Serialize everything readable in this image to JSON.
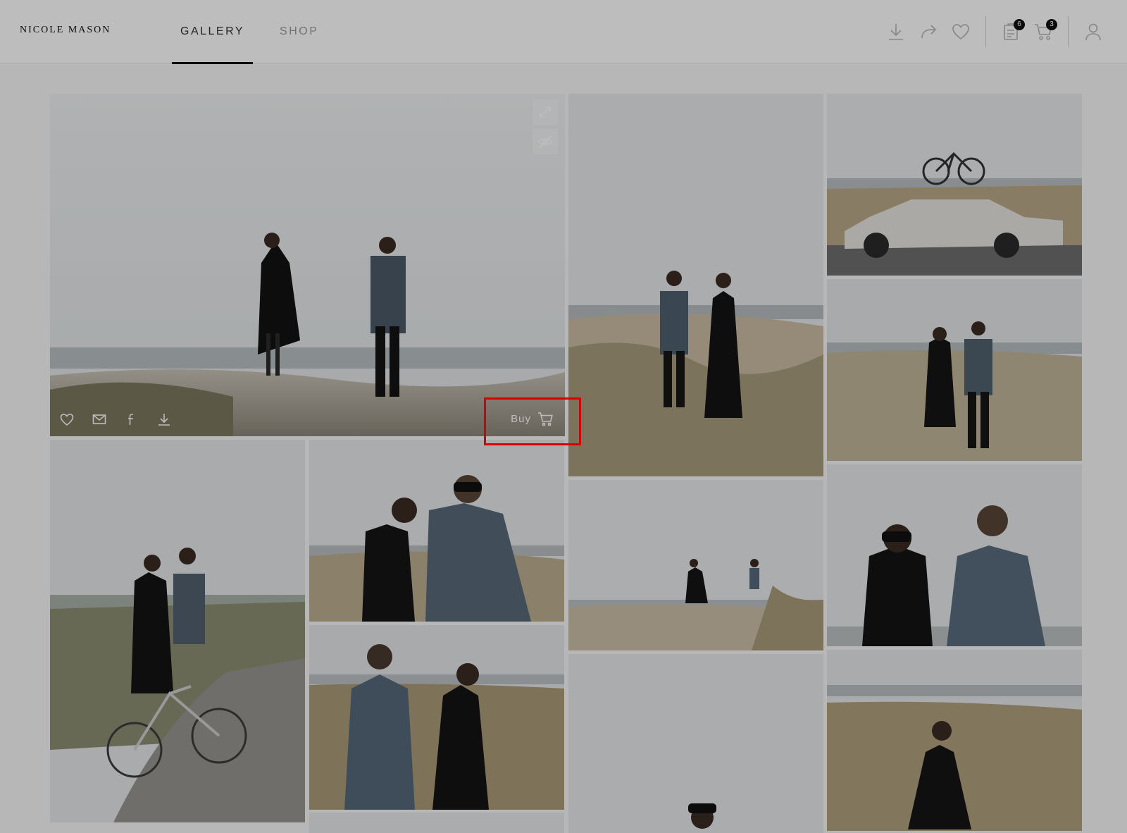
{
  "header": {
    "brand": "NICOLE MASON",
    "tabs": [
      {
        "label": "GALLERY",
        "active": true
      },
      {
        "label": "SHOP",
        "active": false
      }
    ],
    "icons": {
      "download": "download-icon",
      "share": "share-icon",
      "favorite": "heart-icon",
      "clipboard": "clipboard-icon",
      "cart": "cart-icon",
      "account": "user-icon"
    },
    "clipboard_count": "6",
    "cart_count": "3"
  },
  "featured_photo": {
    "buy_label": "Buy",
    "icons": [
      "heart-icon",
      "email-icon",
      "facebook-icon",
      "download-icon"
    ],
    "top_icons": [
      "expand-icon",
      "eye-hide-icon"
    ]
  },
  "colors": {
    "highlight": "#d60000",
    "badge": "#111111"
  }
}
